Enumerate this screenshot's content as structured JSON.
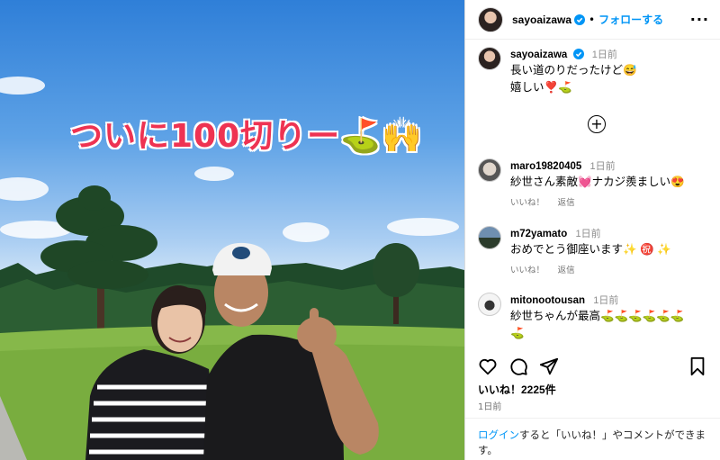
{
  "photo": {
    "overlay_text": "ついに100切りー⛳🙌"
  },
  "header": {
    "username": "sayoaizawa",
    "separator": "•",
    "follow_label": "フォローする",
    "more_label": "···"
  },
  "caption": {
    "username": "sayoaizawa",
    "time": "1日前",
    "line1": "長い道のりだったけど😅",
    "line2": "嬉しい❣️⛳"
  },
  "comments": [
    {
      "username": "maro19820405",
      "time": "1日前",
      "text": "紗世さん素敵💓ナカジ羨ましい😍",
      "like_label": "いいね！",
      "reply_label": "返信"
    },
    {
      "username": "m72yamato",
      "time": "1日前",
      "text": "おめでとう御座います✨ ㊗️ ✨",
      "like_label": "いいね！",
      "reply_label": "返信"
    },
    {
      "username": "mitonootousan",
      "time": "1日前",
      "text_line1": "紗世ちゃんが最高⛳⛳⛳⛳⛳⛳",
      "text_line2": "⛳"
    }
  ],
  "likes": "いいね！2225件",
  "posted": "1日前",
  "login_prompt": {
    "link": "ログイン",
    "rest": "すると「いいね！」やコメントができます。"
  },
  "icons": [
    "heart-icon",
    "comment-icon",
    "share-icon",
    "bookmark-icon",
    "add-comment-icon",
    "verified-icon",
    "more-icon"
  ]
}
